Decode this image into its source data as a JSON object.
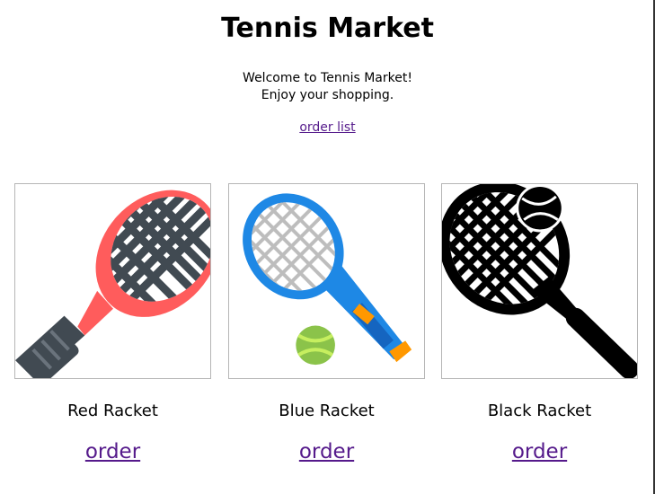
{
  "header": {
    "title": "Tennis Market",
    "welcome_line1": "Welcome to Tennis Market!",
    "welcome_line2": "Enjoy your shopping.",
    "order_list_link": "order list"
  },
  "products": [
    {
      "name": "Red Racket",
      "order_label": "order",
      "icon": "red-racket-icon",
      "color": "#ff5c5c"
    },
    {
      "name": "Blue Racket",
      "order_label": "order",
      "icon": "blue-racket-icon",
      "color": "#1e88e5"
    },
    {
      "name": "Black Racket",
      "order_label": "order",
      "icon": "black-racket-icon",
      "color": "#000000"
    }
  ]
}
